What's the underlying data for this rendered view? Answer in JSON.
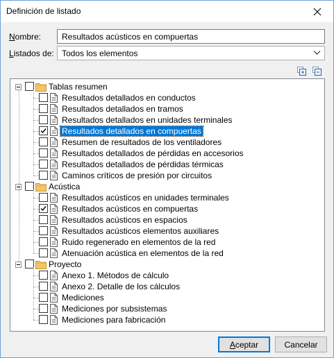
{
  "window": {
    "title": "Definición de listado"
  },
  "form": {
    "name_label_u": "N",
    "name_label_rest": "ombre:",
    "name_value": "Resultados acústicos en compuertas",
    "list_label_u": "L",
    "list_label_rest": "istados de:",
    "list_value": "Todos los elementos"
  },
  "tree": {
    "groups": [
      {
        "label": "Tablas resumen",
        "items": [
          {
            "label": "Resultados detallados en conductos",
            "checked": false
          },
          {
            "label": "Resultados detallados en tramos",
            "checked": false
          },
          {
            "label": "Resultados detallados en unidades terminales",
            "checked": false
          },
          {
            "label": "Resultados detallados en compuertas",
            "checked": true,
            "selected": true
          },
          {
            "label": "Resumen de resultados de los ventiladores",
            "checked": false
          },
          {
            "label": "Resultados detallados de pérdidas en accesorios",
            "checked": false
          },
          {
            "label": "Resultados detallados de pérdidas térmicas",
            "checked": false
          },
          {
            "label": "Caminos críticos de presión por circuitos",
            "checked": false
          }
        ]
      },
      {
        "label": "Acústica",
        "items": [
          {
            "label": "Resultados acústicos en unidades terminales",
            "checked": false
          },
          {
            "label": "Resultados acústicos en compuertas",
            "checked": true
          },
          {
            "label": "Resultados acústicos en espacios",
            "checked": false
          },
          {
            "label": "Resultados acústicos elementos auxiliares",
            "checked": false
          },
          {
            "label": "Ruido regenerado en elementos de la red",
            "checked": false
          },
          {
            "label": "Atenuación acústica en elementos de la red",
            "checked": false
          }
        ]
      },
      {
        "label": "Proyecto",
        "items": [
          {
            "label": "Anexo 1. Métodos de cálculo",
            "checked": false
          },
          {
            "label": "Anexo 2. Detalle de los cálculos",
            "checked": false
          },
          {
            "label": "Mediciones",
            "checked": false
          },
          {
            "label": "Mediciones por subsistemas",
            "checked": false
          },
          {
            "label": "Mediciones para fabricación",
            "checked": false
          }
        ]
      }
    ]
  },
  "buttons": {
    "ok_u": "A",
    "ok_rest": "ceptar",
    "cancel": "Cancelar"
  },
  "icons": [
    "close-icon",
    "chevron-down-icon",
    "expand-all-icon",
    "collapse-all-icon",
    "folder-icon",
    "document-icon",
    "checkmark-icon"
  ],
  "colors": {
    "selection": "#0078d7",
    "folder": "#f5c469",
    "accent_border": "#0078d7"
  }
}
